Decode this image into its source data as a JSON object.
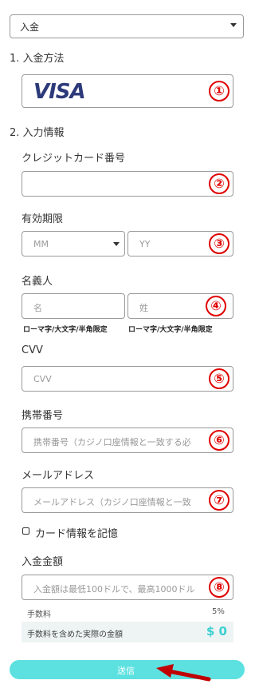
{
  "top_select": {
    "value": "入金"
  },
  "step1": {
    "label": "1. 入金方法",
    "card_brand": "VISA"
  },
  "step2": {
    "label": "2. 入力情報"
  },
  "card_number": {
    "label": "クレジットカード番号",
    "value": ""
  },
  "expiry": {
    "label": "有効期限",
    "month_value": "MM",
    "year_placeholder": "YY"
  },
  "holder": {
    "label": "名義人",
    "first_placeholder": "名",
    "last_placeholder": "姓",
    "hint_first": "ローマ字/大文字/半角限定",
    "hint_last": "ローマ字/大文字/半角限定"
  },
  "cvv": {
    "label": "CVV",
    "placeholder": "CVV"
  },
  "phone": {
    "label": "携帯番号",
    "placeholder": "携帯番号（カジノ口座情報と一致する必"
  },
  "email": {
    "label": "メールアドレス",
    "placeholder": "メールアドレス（カジノ口座情報と一致"
  },
  "remember": {
    "label": "カード情報を記憶",
    "checked": false
  },
  "amount": {
    "label": "入金金額",
    "placeholder": "入金額は最低100ドルで、最高1000ドル"
  },
  "fee": {
    "label": "手数料",
    "value": "5%"
  },
  "actual": {
    "label": "手数料を含めた実際の金額",
    "value": "$ 0"
  },
  "submit": {
    "label": "送信"
  },
  "markers": [
    "①",
    "②",
    "③",
    "④",
    "⑤",
    "⑥",
    "⑦",
    "⑧"
  ],
  "colors": {
    "accent": "#5ce1e0",
    "marker": "#e00000",
    "visa_blue": "#2d3a7a",
    "amount_teal": "#3ccfd0"
  }
}
